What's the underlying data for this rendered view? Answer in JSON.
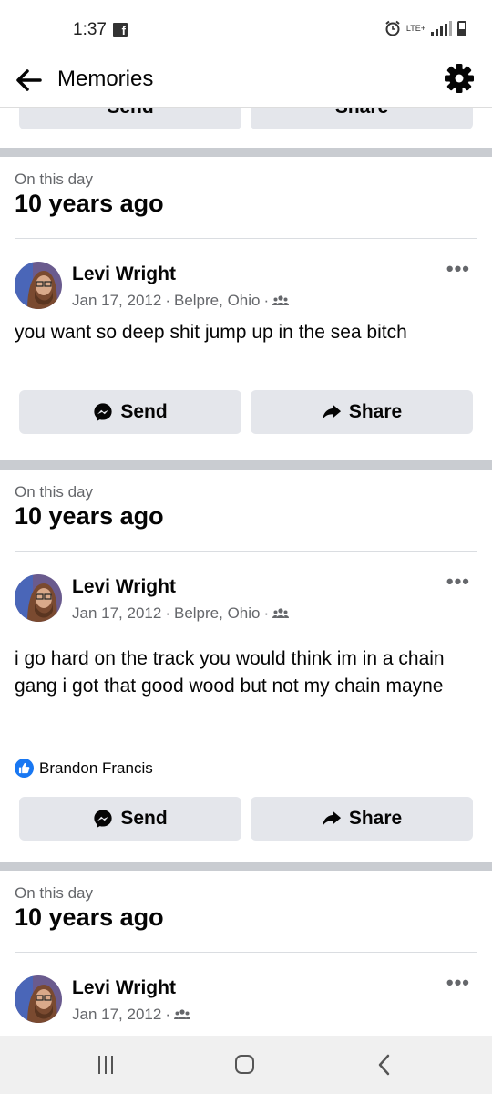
{
  "status_bar": {
    "time": "1:37",
    "network": "LTE+"
  },
  "header": {
    "title": "Memories"
  },
  "top_buttons": {
    "send_label": "Send",
    "share_label": "Share"
  },
  "memories": [
    {
      "label": "On this day",
      "years": "10 years ago",
      "author": "Levi Wright",
      "date": "Jan 17, 2012",
      "location": "Belpre, Ohio",
      "text": "you want so deep shit jump up in the sea bitch",
      "send_label": "Send",
      "share_label": "Share"
    },
    {
      "label": "On this day",
      "years": "10 years ago",
      "author": "Levi Wright",
      "date": "Jan 17, 2012",
      "location": "Belpre, Ohio",
      "text": "i go hard on the track you would think im in a chain gang i got that good wood but not my chain mayne",
      "liked_by": "Brandon Francis",
      "send_label": "Send",
      "share_label": "Share"
    },
    {
      "label": "On this day",
      "years": "10 years ago",
      "author": "Levi Wright",
      "date": "Jan 17, 2012"
    }
  ],
  "colors": {
    "accent": "#1877f2",
    "button_bg": "#e4e6eb",
    "divider": "#c9ccd1",
    "secondary_text": "#65676b"
  }
}
